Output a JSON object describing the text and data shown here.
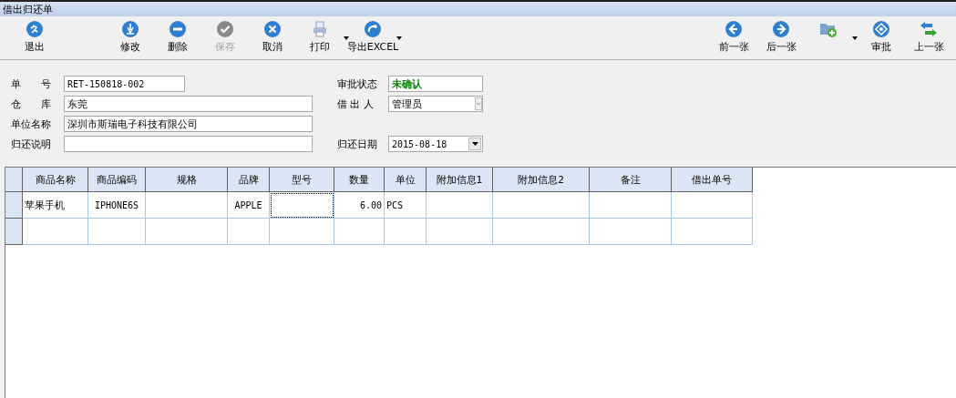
{
  "window": {
    "title": "借出归还单"
  },
  "toolbar_left": [
    {
      "label": "退出",
      "kind": "button",
      "disabled": false
    },
    {
      "label": "修改",
      "kind": "button",
      "disabled": false
    },
    {
      "label": "删除",
      "kind": "button",
      "disabled": false
    },
    {
      "label": "保存",
      "kind": "button",
      "disabled": true
    },
    {
      "label": "取消",
      "kind": "button",
      "disabled": false
    },
    {
      "label": "打印",
      "kind": "menu",
      "disabled": false
    },
    {
      "label": "导出EXCEL",
      "kind": "menu",
      "disabled": false
    }
  ],
  "toolbar_right": [
    {
      "label": "前一张",
      "kind": "button"
    },
    {
      "label": "后一张",
      "kind": "button"
    },
    {
      "kind": "menu"
    },
    {
      "label": "审批",
      "kind": "button"
    },
    {
      "label": "上一张",
      "kind": "button"
    }
  ],
  "form_left": [
    {
      "label": "单　　号",
      "value": "RET-150818-002",
      "kind": "short"
    },
    {
      "label": "仓　　库",
      "value": "东莞",
      "kind": "wide"
    },
    {
      "label": "单位名称",
      "value": "深圳市斯瑞电子科技有限公司",
      "kind": "wide"
    },
    {
      "label": "归还说明",
      "kind": "wide"
    }
  ],
  "form_right": [
    {
      "label": "审批状态",
      "value": "未确认",
      "kind": "status"
    },
    {
      "label": "借 出 人",
      "value": "管理员",
      "kind": "select"
    },
    {
      "kind": "blank"
    },
    {
      "label": "归还日期",
      "value": "2015-08-18",
      "kind": "date"
    }
  ],
  "table": {
    "columns": [
      "商品名称",
      "商品编码",
      "规格",
      "品牌",
      "型号",
      "数量",
      "单位",
      "附加信息1",
      "附加信息2",
      "备注",
      "借出单号"
    ],
    "rows": [
      {
        "cells": [
          {
            "text": "苹果手机",
            "focused": false
          },
          {
            "text": "IPHONE6S",
            "focused": false
          },
          {
            "focused": false
          },
          {
            "text": "APPLE",
            "focused": false
          },
          {
            "focused": true
          },
          {
            "text": "6.00",
            "focused": false
          },
          {
            "text": "PCS",
            "focused": false
          },
          {
            "focused": false
          },
          {
            "focused": false
          },
          {
            "focused": false
          },
          {
            "focused": false
          }
        ]
      },
      {
        "cells": [
          {
            "focused": false
          },
          {
            "focused": false
          },
          {
            "focused": false
          },
          {
            "focused": false
          },
          {
            "focused": false
          },
          {
            "focused": false
          },
          {
            "focused": false
          },
          {
            "focused": false
          },
          {
            "focused": false
          },
          {
            "focused": false
          },
          {
            "focused": false
          }
        ]
      }
    ]
  }
}
